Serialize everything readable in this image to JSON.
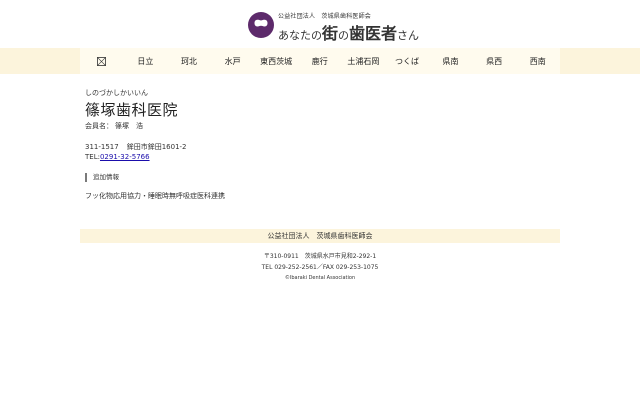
{
  "header": {
    "logo_icon": "tooth-icon",
    "brand_color": "#5d2a6b",
    "logo_sub": "公益社団法人　茨城県歯科医師会",
    "logo_prefix": "あなたの",
    "logo_big1": "街",
    "logo_mid": "の",
    "logo_big2": "歯医者",
    "logo_suffix": "さん"
  },
  "nav": {
    "home_icon": "home-icon",
    "items": [
      "日立",
      "珂北",
      "水戸",
      "東西茨城",
      "鹿行",
      "土浦石岡",
      "つくば",
      "県南",
      "県西",
      "西南"
    ]
  },
  "clinic": {
    "kana": "しのづかしかいいん",
    "name": "篠塚歯科医院",
    "member_label": "会員名：",
    "member_name": "篠塚　浩",
    "postal": "311-1517",
    "address": "鉾田市鉾田1601-2",
    "tel_label": "TEL:",
    "tel": "0291-32-5766",
    "extra_heading": "追加情報",
    "extra_text": "フッ化物応用協力・睡眠時無呼吸症医科連携"
  },
  "footer": {
    "org": "公益社団法人　茨城県歯科医師会",
    "address": "〒310-0911　茨城県水戸市見和2-292-1",
    "contact": "TEL 029-252-2561／FAX 029-253-1075",
    "copyright": "©Ibaraki Dental Association"
  }
}
